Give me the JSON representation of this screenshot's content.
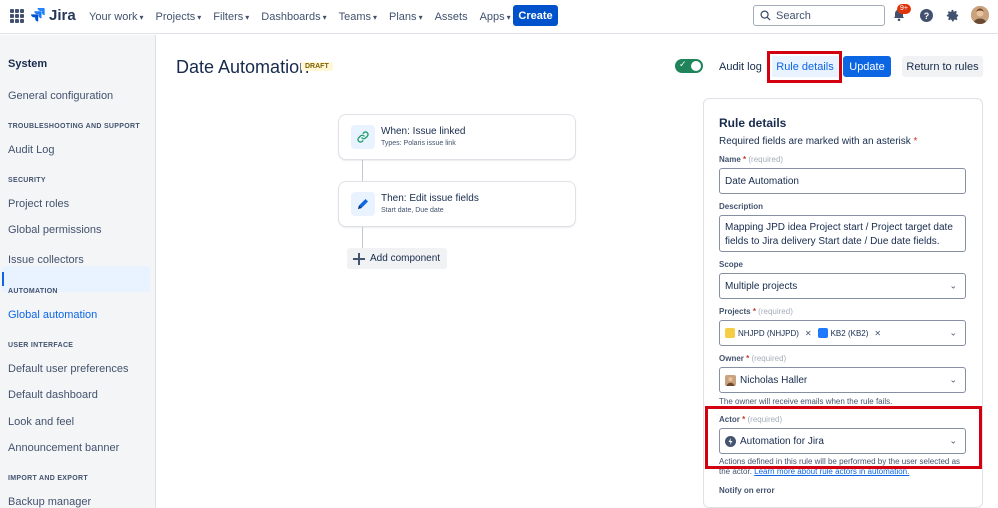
{
  "nav": {
    "logo": "Jira",
    "items": [
      {
        "label": "Your work",
        "caret": true
      },
      {
        "label": "Projects",
        "caret": true
      },
      {
        "label": "Filters",
        "caret": true
      },
      {
        "label": "Dashboards",
        "caret": true
      },
      {
        "label": "Teams",
        "caret": true
      },
      {
        "label": "Plans",
        "caret": true
      },
      {
        "label": "Assets",
        "caret": false
      },
      {
        "label": "Apps",
        "caret": true
      }
    ],
    "create_label": "Create",
    "search_placeholder": "Search",
    "notification_badge": "9+"
  },
  "sidebar": {
    "title": "System",
    "general_configuration": "General configuration",
    "sections": [
      {
        "heading": "TROUBLESHOOTING AND SUPPORT",
        "items": [
          "Audit Log"
        ]
      },
      {
        "heading": "SECURITY",
        "items": [
          "Project roles",
          "Global permissions",
          "Issue collectors"
        ]
      },
      {
        "heading": "AUTOMATION",
        "items": [
          "Global automation"
        ]
      },
      {
        "heading": "USER INTERFACE",
        "items": [
          "Default user preferences",
          "Default dashboard",
          "Look and feel",
          "Announcement banner"
        ]
      },
      {
        "heading": "IMPORT AND EXPORT",
        "items": [
          "Backup manager"
        ]
      }
    ],
    "active_item": "Global automation"
  },
  "header": {
    "title": "Date Automation",
    "status_badge": "DRAFT",
    "audit_log": "Audit log",
    "rule_details": "Rule details",
    "update": "Update",
    "return_to_rules": "Return to rules"
  },
  "flow": {
    "trigger": {
      "title": "When: Issue linked",
      "subtitle": "Types: Polaris issue link"
    },
    "action": {
      "title": "Then: Edit issue fields",
      "subtitle": "Start date, Due date"
    },
    "add_component": "Add component"
  },
  "rule_details": {
    "title": "Rule details",
    "required_note": "Required fields are marked with an asterisk",
    "name": {
      "label": "Name",
      "required": "(required)",
      "value": "Date Automation"
    },
    "description": {
      "label": "Description",
      "value": "Mapping JPD idea Project start / Project target date fields to Jira delivery Start date / Due date fields."
    },
    "scope": {
      "label": "Scope",
      "value": "Multiple projects"
    },
    "projects": {
      "label": "Projects",
      "required": "(required)",
      "values": [
        "NHJPD (NHJPD)",
        "KB2 (KB2)"
      ]
    },
    "owner": {
      "label": "Owner",
      "required": "(required)",
      "value": "Nicholas Haller",
      "helper": "The owner will receive emails when the rule fails."
    },
    "actor": {
      "label": "Actor",
      "required": "(required)",
      "value": "Automation for Jira",
      "helper": "Actions defined in this rule will be performed by the user selected as the actor.",
      "helper_link": "Learn more about rule actors in automation."
    },
    "notify_on_error": {
      "label": "Notify on error"
    }
  },
  "colors": {
    "primary": "#0c66e4",
    "nav_create": "#0052cc",
    "toggle_on": "#1f845a",
    "highlight": "#d3000f"
  }
}
